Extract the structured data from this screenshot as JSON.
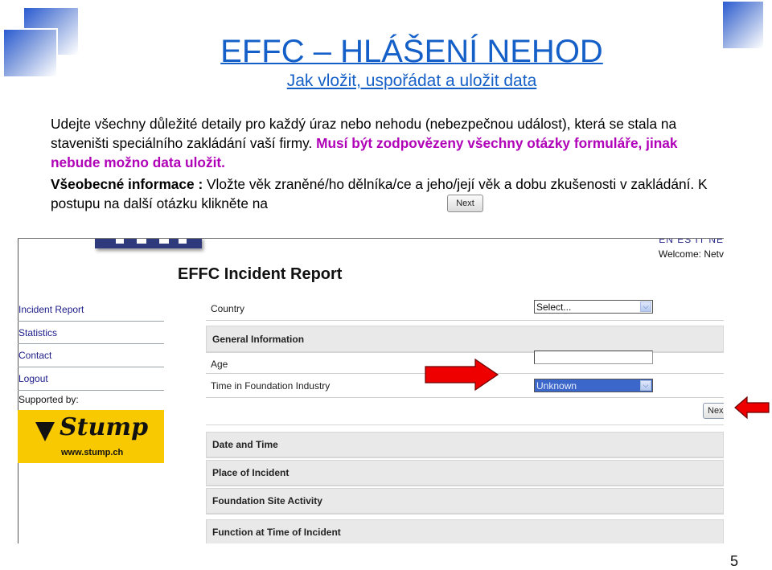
{
  "slide": {
    "title": "EFFC – HLÁŠENÍ NEHOD",
    "subtitle": "Jak vložit, uspořádat a uložit data",
    "intro_text": "Udejte všechny důležité detaily pro každý úraz nebo nehodu (nebezpečnou událost), která se stala na staveništi speciálního zakládání vaší firmy. ",
    "intro_emphasis": "Musí být zodpovězeny všechny otázky formuláře, jinak nebude možno data uložit.",
    "info_label": "Všeobecné informace :",
    "info_text": " Vložte věk zraněné/ho dělníka/ce a jeho/její věk a dobu zkušenosti v zakládání.  K postupu na další otázku klikněte na",
    "inline_next_label": "Next",
    "page_number": "5",
    "accent_color": "#1560c8",
    "emphasis_color": "#b000b8"
  },
  "screenshot": {
    "languages": "EN ES IT NE",
    "welcome": "Welcome: Netv",
    "report_title": "EFFC Incident Report",
    "nav": [
      {
        "label": "Incident Report"
      },
      {
        "label": "Statistics"
      },
      {
        "label": "Contact"
      },
      {
        "label": "Logout"
      }
    ],
    "supported_by": "Supported by:",
    "sponsor": {
      "name": "Stump",
      "url": "www.stump.ch",
      "color": "#f8c800"
    },
    "form": {
      "country_label": "Country",
      "country_value": "Select...",
      "general_info_header": "General Information",
      "age_label": "Age",
      "age_value": "",
      "time_label": "Time in Foundation Industry",
      "time_value": "Unknown",
      "next_label": "Nex",
      "sections": [
        {
          "label": "Date and Time"
        },
        {
          "label": "Place of Incident"
        },
        {
          "label": "Foundation Site Activity"
        },
        {
          "label": "Function at Time of Incident"
        }
      ]
    }
  },
  "annotations": {
    "arrow_color": "#ee0000"
  }
}
